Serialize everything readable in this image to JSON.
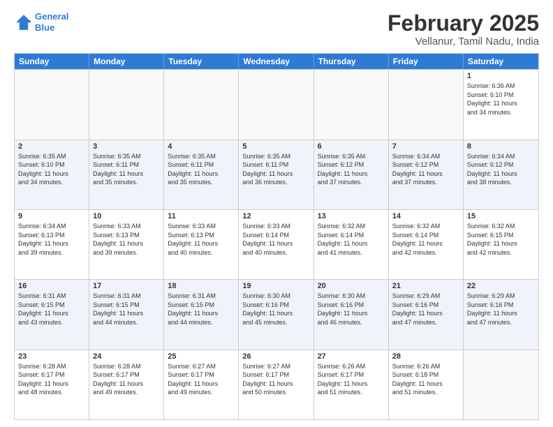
{
  "logo": {
    "line1": "General",
    "line2": "Blue"
  },
  "title": "February 2025",
  "subtitle": "Vellanur, Tamil Nadu, India",
  "days_of_week": [
    "Sunday",
    "Monday",
    "Tuesday",
    "Wednesday",
    "Thursday",
    "Friday",
    "Saturday"
  ],
  "weeks": [
    {
      "alt": false,
      "cells": [
        {
          "day": "",
          "empty": true,
          "text": ""
        },
        {
          "day": "",
          "empty": true,
          "text": ""
        },
        {
          "day": "",
          "empty": true,
          "text": ""
        },
        {
          "day": "",
          "empty": true,
          "text": ""
        },
        {
          "day": "",
          "empty": true,
          "text": ""
        },
        {
          "day": "",
          "empty": true,
          "text": ""
        },
        {
          "day": "1",
          "empty": false,
          "text": "Sunrise: 6:36 AM\nSunset: 6:10 PM\nDaylight: 11 hours\nand 34 minutes."
        }
      ]
    },
    {
      "alt": true,
      "cells": [
        {
          "day": "2",
          "empty": false,
          "text": "Sunrise: 6:35 AM\nSunset: 6:10 PM\nDaylight: 11 hours\nand 34 minutes."
        },
        {
          "day": "3",
          "empty": false,
          "text": "Sunrise: 6:35 AM\nSunset: 6:11 PM\nDaylight: 11 hours\nand 35 minutes."
        },
        {
          "day": "4",
          "empty": false,
          "text": "Sunrise: 6:35 AM\nSunset: 6:11 PM\nDaylight: 11 hours\nand 35 minutes."
        },
        {
          "day": "5",
          "empty": false,
          "text": "Sunrise: 6:35 AM\nSunset: 6:11 PM\nDaylight: 11 hours\nand 36 minutes."
        },
        {
          "day": "6",
          "empty": false,
          "text": "Sunrise: 6:35 AM\nSunset: 6:12 PM\nDaylight: 11 hours\nand 37 minutes."
        },
        {
          "day": "7",
          "empty": false,
          "text": "Sunrise: 6:34 AM\nSunset: 6:12 PM\nDaylight: 11 hours\nand 37 minutes."
        },
        {
          "day": "8",
          "empty": false,
          "text": "Sunrise: 6:34 AM\nSunset: 6:12 PM\nDaylight: 11 hours\nand 38 minutes."
        }
      ]
    },
    {
      "alt": false,
      "cells": [
        {
          "day": "9",
          "empty": false,
          "text": "Sunrise: 6:34 AM\nSunset: 6:13 PM\nDaylight: 11 hours\nand 39 minutes."
        },
        {
          "day": "10",
          "empty": false,
          "text": "Sunrise: 6:33 AM\nSunset: 6:13 PM\nDaylight: 11 hours\nand 39 minutes."
        },
        {
          "day": "11",
          "empty": false,
          "text": "Sunrise: 6:33 AM\nSunset: 6:13 PM\nDaylight: 11 hours\nand 40 minutes."
        },
        {
          "day": "12",
          "empty": false,
          "text": "Sunrise: 6:33 AM\nSunset: 6:14 PM\nDaylight: 11 hours\nand 40 minutes."
        },
        {
          "day": "13",
          "empty": false,
          "text": "Sunrise: 6:32 AM\nSunset: 6:14 PM\nDaylight: 11 hours\nand 41 minutes."
        },
        {
          "day": "14",
          "empty": false,
          "text": "Sunrise: 6:32 AM\nSunset: 6:14 PM\nDaylight: 11 hours\nand 42 minutes."
        },
        {
          "day": "15",
          "empty": false,
          "text": "Sunrise: 6:32 AM\nSunset: 6:15 PM\nDaylight: 11 hours\nand 42 minutes."
        }
      ]
    },
    {
      "alt": true,
      "cells": [
        {
          "day": "16",
          "empty": false,
          "text": "Sunrise: 6:31 AM\nSunset: 6:15 PM\nDaylight: 11 hours\nand 43 minutes."
        },
        {
          "day": "17",
          "empty": false,
          "text": "Sunrise: 6:31 AM\nSunset: 6:15 PM\nDaylight: 11 hours\nand 44 minutes."
        },
        {
          "day": "18",
          "empty": false,
          "text": "Sunrise: 6:31 AM\nSunset: 6:15 PM\nDaylight: 11 hours\nand 44 minutes."
        },
        {
          "day": "19",
          "empty": false,
          "text": "Sunrise: 6:30 AM\nSunset: 6:16 PM\nDaylight: 11 hours\nand 45 minutes."
        },
        {
          "day": "20",
          "empty": false,
          "text": "Sunrise: 6:30 AM\nSunset: 6:16 PM\nDaylight: 11 hours\nand 46 minutes."
        },
        {
          "day": "21",
          "empty": false,
          "text": "Sunrise: 6:29 AM\nSunset: 6:16 PM\nDaylight: 11 hours\nand 47 minutes."
        },
        {
          "day": "22",
          "empty": false,
          "text": "Sunrise: 6:29 AM\nSunset: 6:16 PM\nDaylight: 11 hours\nand 47 minutes."
        }
      ]
    },
    {
      "alt": false,
      "cells": [
        {
          "day": "23",
          "empty": false,
          "text": "Sunrise: 6:28 AM\nSunset: 6:17 PM\nDaylight: 11 hours\nand 48 minutes."
        },
        {
          "day": "24",
          "empty": false,
          "text": "Sunrise: 6:28 AM\nSunset: 6:17 PM\nDaylight: 11 hours\nand 49 minutes."
        },
        {
          "day": "25",
          "empty": false,
          "text": "Sunrise: 6:27 AM\nSunset: 6:17 PM\nDaylight: 11 hours\nand 49 minutes."
        },
        {
          "day": "26",
          "empty": false,
          "text": "Sunrise: 6:27 AM\nSunset: 6:17 PM\nDaylight: 11 hours\nand 50 minutes."
        },
        {
          "day": "27",
          "empty": false,
          "text": "Sunrise: 6:26 AM\nSunset: 6:17 PM\nDaylight: 11 hours\nand 51 minutes."
        },
        {
          "day": "28",
          "empty": false,
          "text": "Sunrise: 6:26 AM\nSunset: 6:18 PM\nDaylight: 11 hours\nand 51 minutes."
        },
        {
          "day": "",
          "empty": true,
          "text": ""
        }
      ]
    }
  ]
}
